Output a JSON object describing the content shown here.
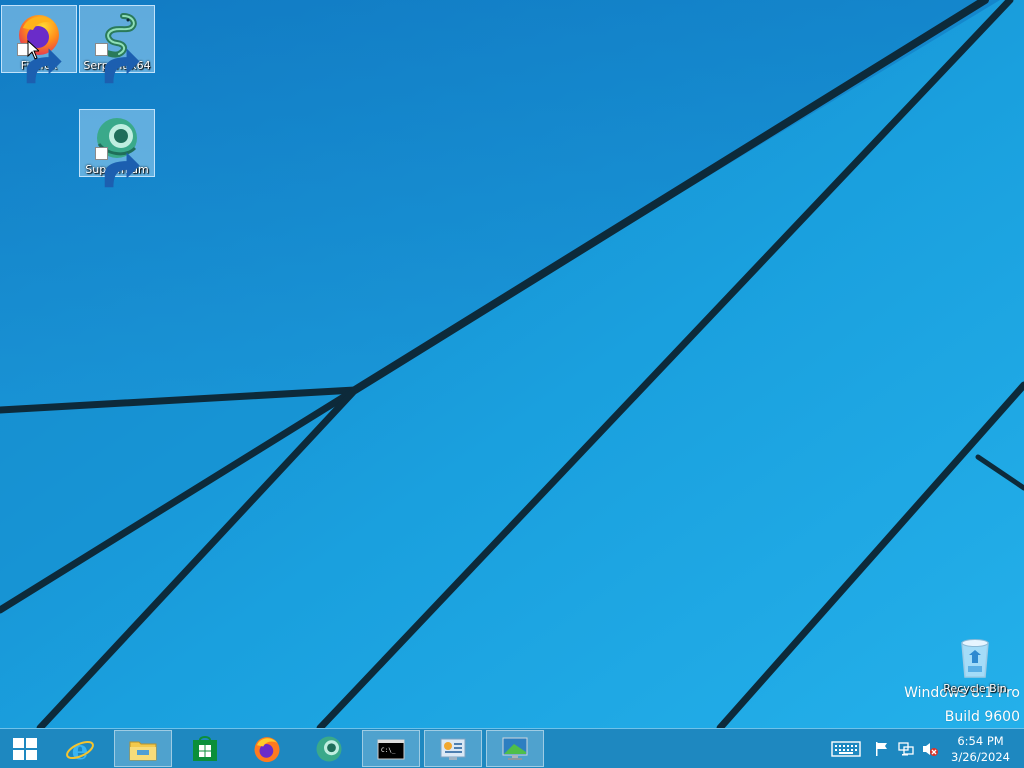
{
  "desktop": {
    "icons": [
      {
        "label": "Firefox",
        "icon": "firefox-icon"
      },
      {
        "label": "Serpent x64",
        "icon": "serpent-icon"
      },
      {
        "label": "Supermium",
        "icon": "supermium-icon"
      },
      {
        "label": "Recycle Bin",
        "icon": "recycle-bin-icon"
      }
    ],
    "watermark_line1": "Windows 8.1 Pro",
    "watermark_line2": "Build 9600"
  },
  "taskbar": {
    "buttons": [
      {
        "name": "start",
        "icon": "windows-logo-icon"
      },
      {
        "name": "internet-explorer",
        "icon": "ie-icon"
      },
      {
        "name": "file-explorer",
        "icon": "folder-icon"
      },
      {
        "name": "store",
        "icon": "store-icon"
      },
      {
        "name": "firefox",
        "icon": "firefox-icon"
      },
      {
        "name": "supermium",
        "icon": "supermium-icon"
      },
      {
        "name": "command-prompt",
        "icon": "cmd-icon"
      },
      {
        "name": "control-panel",
        "icon": "control-panel-icon"
      },
      {
        "name": "remote-desktop",
        "icon": "monitor-icon"
      }
    ],
    "tray": {
      "icons": [
        "keyboard-icon",
        "flag-icon",
        "network-icon",
        "volume-muted-icon"
      ],
      "time": "6:54 PM",
      "date": "3/26/2024"
    }
  },
  "colors": {
    "wallpaper": "#1b9ad6",
    "taskbar": "#1e87be",
    "stripe": "#0d2a3a"
  }
}
